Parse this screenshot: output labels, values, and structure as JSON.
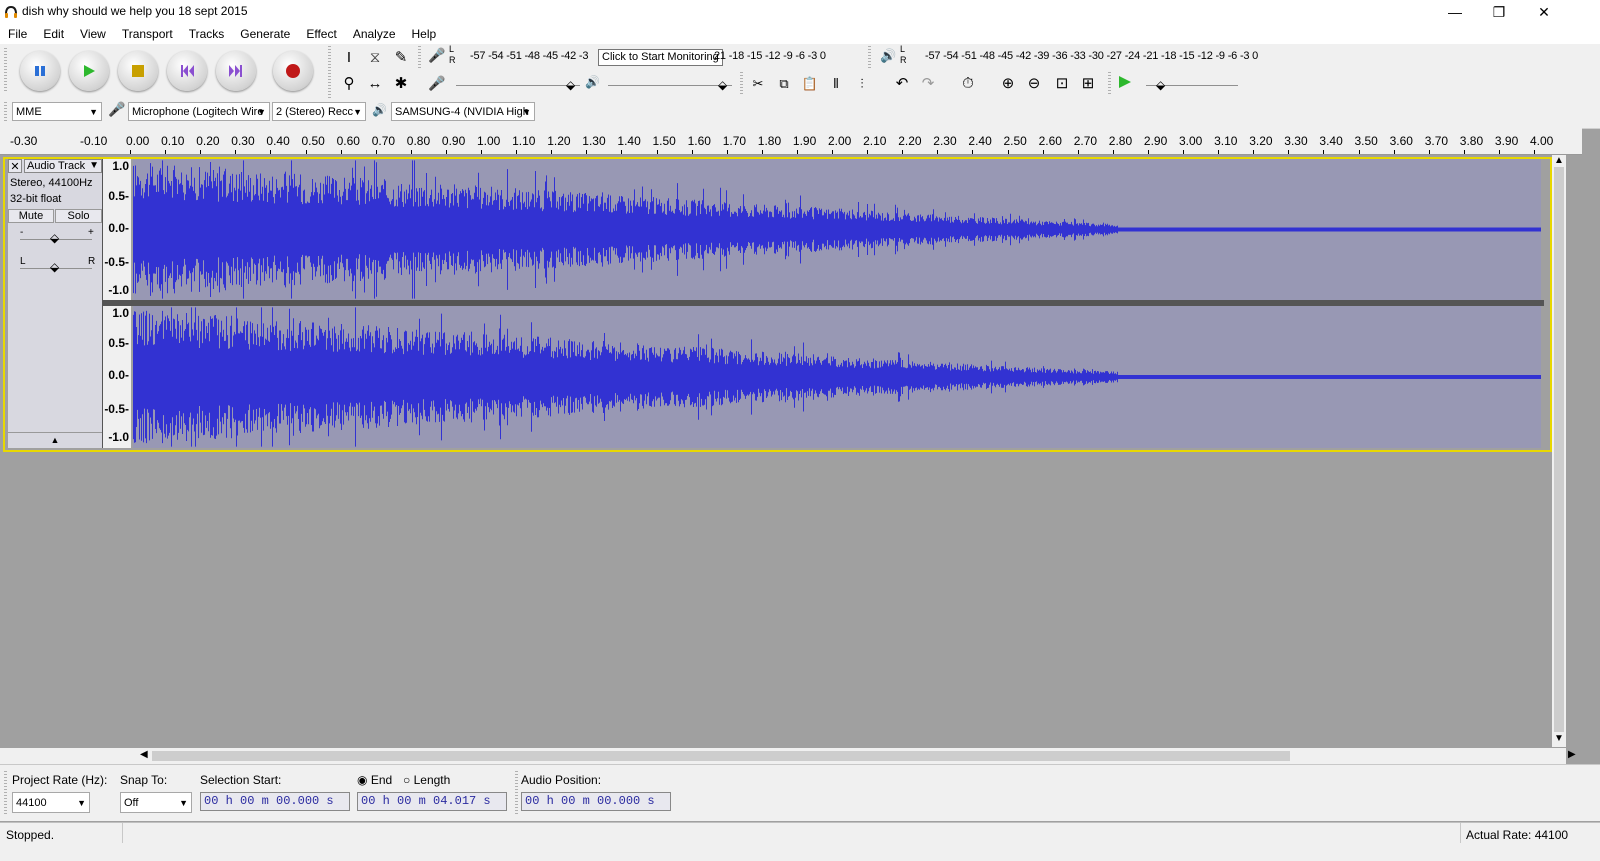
{
  "window": {
    "title": "dish why should we help you 18 sept 2015",
    "minimize": "—",
    "maximize": "❐",
    "close": "✕"
  },
  "menu": [
    "File",
    "Edit",
    "View",
    "Transport",
    "Tracks",
    "Generate",
    "Effect",
    "Analyze",
    "Help"
  ],
  "transport": {
    "pause": "pause-icon",
    "play": "play-icon",
    "stop": "stop-icon",
    "skip_start": "skip-to-start-icon",
    "skip_end": "skip-to-end-icon",
    "record": "record-icon",
    "colors": {
      "play": "#2db82d",
      "stop": "#c8a000",
      "skip": "#8a4fd0",
      "record": "#c01818",
      "pause": "#2a6fd6"
    }
  },
  "meters": {
    "record_scale": "-57 -54 -51 -48 -45 -42 -3",
    "record_tooltip": "Click to Start Monitoring",
    "record_scale_tail": "21 -18 -15 -12  -9  -6  -3  0",
    "play_scale": "-57 -54 -51 -48 -45 -42 -39 -36 -33 -30 -27 -24 -21 -18 -15 -12  -9  -6  -3  0",
    "lr_top": "L",
    "lr_bottom": "R"
  },
  "devices": {
    "host": "MME",
    "input_device": "Microphone (Logitech Wire",
    "channels": "2 (Stereo) Recc",
    "output_device": "SAMSUNG-4 (NVIDIA High"
  },
  "timeline": {
    "pre_labels": [
      "-0.30",
      "-0.10"
    ],
    "labels": [
      "0.00",
      "0.10",
      "0.20",
      "0.30",
      "0.40",
      "0.50",
      "0.60",
      "0.70",
      "0.80",
      "0.90",
      "1.00",
      "1.10",
      "1.20",
      "1.30",
      "1.40",
      "1.50",
      "1.60",
      "1.70",
      "1.80",
      "1.90",
      "2.00",
      "2.10",
      "2.20",
      "2.30",
      "2.40",
      "2.50",
      "2.60",
      "2.70",
      "2.80",
      "2.90",
      "3.00",
      "3.10",
      "3.20",
      "3.30",
      "3.40",
      "3.50",
      "3.60",
      "3.70",
      "3.80",
      "3.90",
      "4.00"
    ]
  },
  "track": {
    "name": "Audio Track",
    "info_1": "Stereo, 44100Hz",
    "info_2": "32-bit float",
    "mute": "Mute",
    "solo": "Solo",
    "gain_minus": "-",
    "gain_plus": "+",
    "pan_left": "L",
    "pan_right": "R",
    "collapse": "▲",
    "vruler": [
      "1.0",
      "0.5-",
      "0.0-",
      "-0.5-",
      "-1.0"
    ],
    "wave_color": "#3232d2",
    "lane_color": "#9898b4"
  },
  "selection_bar": {
    "project_rate_label": "Project Rate (Hz):",
    "project_rate": "44100",
    "snap_label": "Snap To:",
    "snap_value": "Off",
    "selection_start_label": "Selection Start:",
    "selection_start": "00 h 00 m 00.000 s",
    "end_label": "End",
    "length_label": "Length",
    "selection_end": "00 h 00 m 04.017 s",
    "audio_position_label": "Audio Position:",
    "audio_position": "00 h 00 m 00.000 s"
  },
  "status": {
    "left": "Stopped.",
    "right": "Actual Rate: 44100"
  }
}
